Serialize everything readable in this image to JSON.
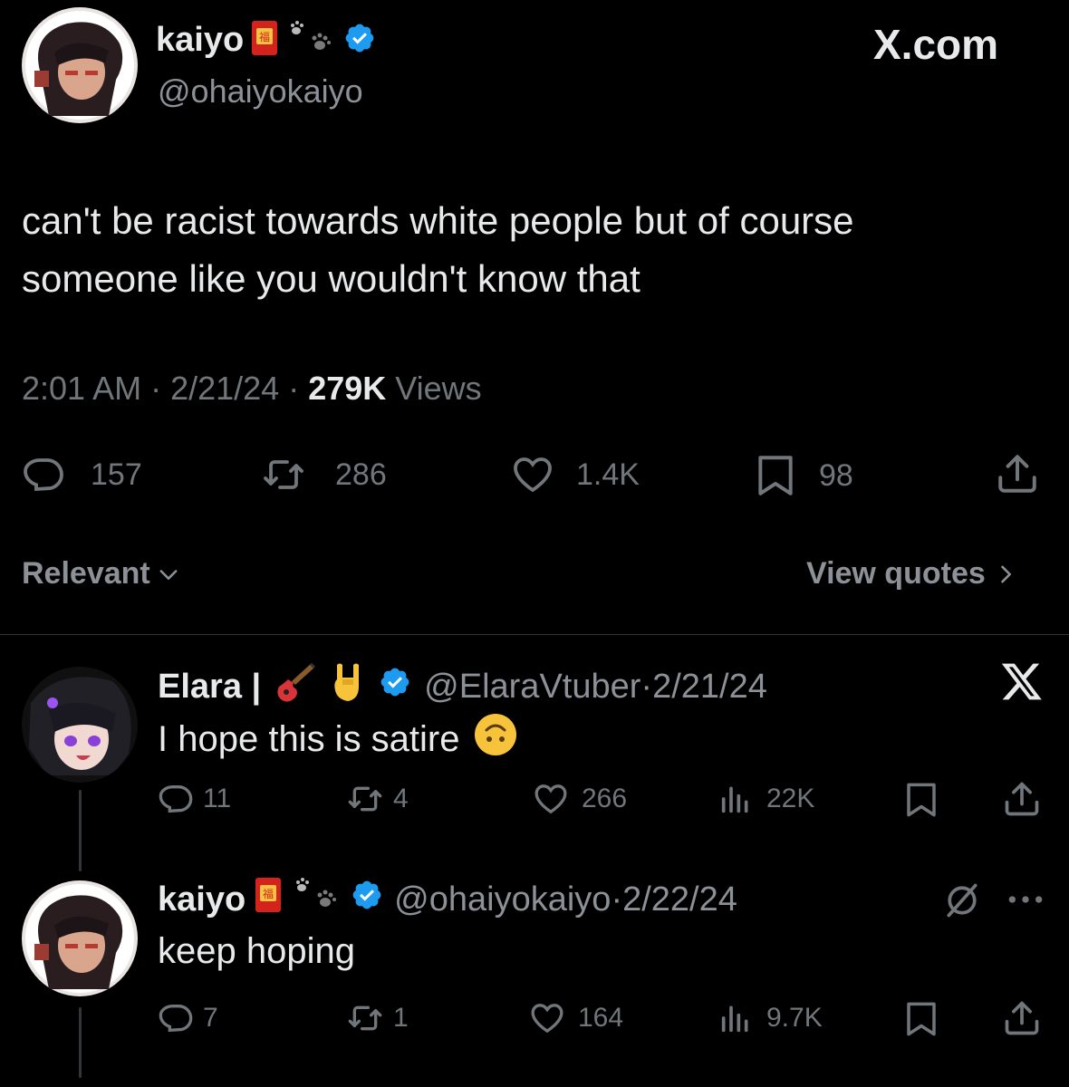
{
  "header": {
    "brand": "X.com"
  },
  "main_tweet": {
    "display_name": "kaiyo",
    "handle": "@ohaiyokaiyo",
    "text_line1": "can't be racist towards white people but of course",
    "text_line2": "someone like you wouldn't know that",
    "time": "2:01 AM",
    "date": "2/21/24",
    "views_count": "279K",
    "views_label": "Views",
    "replies": "157",
    "reposts": "286",
    "likes": "1.4K",
    "bookmarks": "98"
  },
  "sort": {
    "label": "Relevant",
    "view_quotes": "View quotes"
  },
  "replies": [
    {
      "display_name": "Elara |",
      "handle": "@ElaraVtuber",
      "date": "2/21/24",
      "text": "I hope this is satire",
      "replies": "11",
      "reposts": "4",
      "likes": "266",
      "views": "22K"
    },
    {
      "display_name": "kaiyo",
      "handle": "@ohaiyokaiyo",
      "date": "2/22/24",
      "text": "keep hoping",
      "replies": "7",
      "reposts": "1",
      "likes": "164",
      "views": "9.7K"
    }
  ],
  "colors": {
    "background": "#000000",
    "text": "#e7e9ea",
    "muted": "#71767b",
    "verified": "#1d9bf0",
    "divider": "#2f3336"
  }
}
